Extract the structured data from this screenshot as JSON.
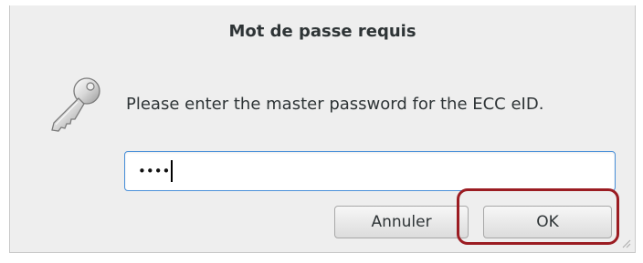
{
  "dialog": {
    "title": "Mot de passe requis",
    "message": "Please enter the master password for the ECC eID.",
    "icon": "key-icon"
  },
  "password_field": {
    "masked_value": "••••"
  },
  "buttons": {
    "cancel_label": "Annuler",
    "ok_label": "OK"
  },
  "colors": {
    "dialog_bg": "#eeeeee",
    "focus_border": "#4a90d9",
    "highlight": "#9b1c22"
  }
}
